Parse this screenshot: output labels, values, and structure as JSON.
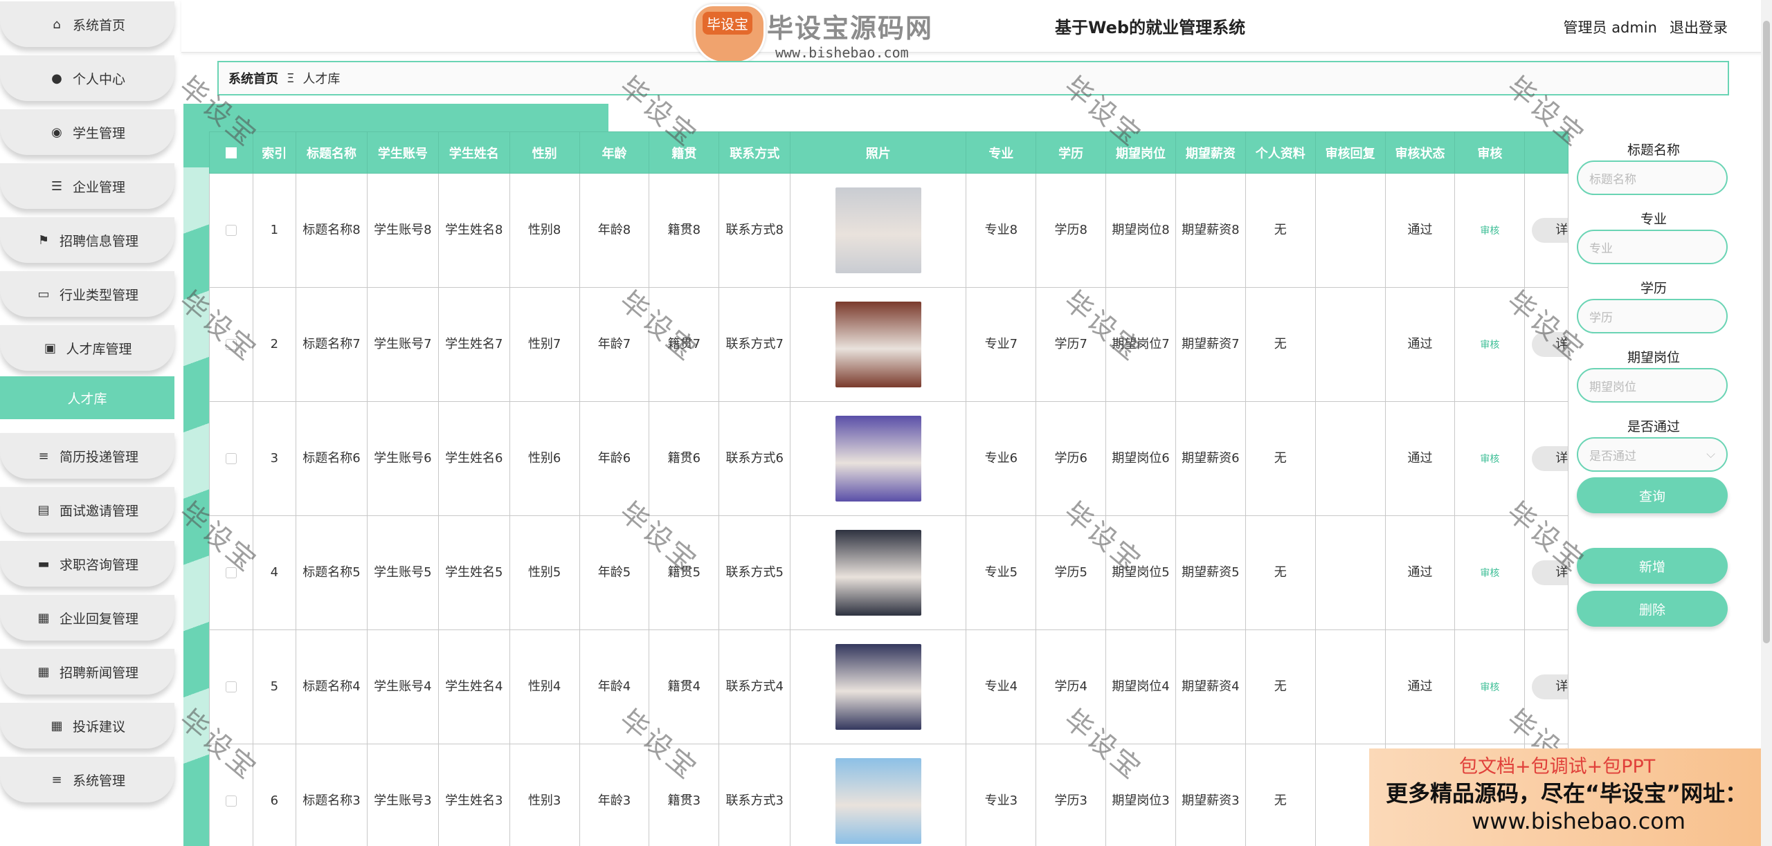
{
  "sidebar": {
    "items": [
      {
        "label": "系统首页",
        "icon": "home-icon"
      },
      {
        "label": "个人中心",
        "icon": "user-icon"
      },
      {
        "label": "学生管理",
        "icon": "pin-icon"
      },
      {
        "label": "企业管理",
        "icon": "sliders-icon"
      },
      {
        "label": "招聘信息管理",
        "icon": "flag-icon"
      },
      {
        "label": "行业类型管理",
        "icon": "monitor-icon"
      },
      {
        "label": "人才库管理",
        "icon": "briefcase-icon"
      },
      {
        "label": "简历投递管理",
        "icon": "list-icon"
      },
      {
        "label": "面试邀请管理",
        "icon": "clipboard-icon"
      },
      {
        "label": "求职咨询管理",
        "icon": "tray-icon"
      },
      {
        "label": "企业回复管理",
        "icon": "grid-icon"
      },
      {
        "label": "招聘新闻管理",
        "icon": "grid-icon"
      },
      {
        "label": "投诉建议",
        "icon": "grid-icon"
      },
      {
        "label": "系统管理",
        "icon": "list-icon"
      }
    ],
    "active_sub": "人才库"
  },
  "header": {
    "title": "基于Web的就业管理系统",
    "user": "管理员 admin",
    "logout": "退出登录"
  },
  "breadcrumb": {
    "home": "系统首页",
    "sep": "Ξ",
    "current": "人才库"
  },
  "table": {
    "columns": [
      "索引",
      "标题名称",
      "学生账号",
      "学生姓名",
      "性别",
      "年龄",
      "籍贯",
      "联系方式",
      "照片",
      "专业",
      "学历",
      "期望岗位",
      "期望薪资",
      "个人资料",
      "审核回复",
      "审核状态",
      "审核",
      ""
    ],
    "rows": [
      {
        "idx": "1",
        "title": "标题名称8",
        "account": "学生账号8",
        "name": "学生姓名8",
        "gender": "性别8",
        "age": "年龄8",
        "origin": "籍贯8",
        "contact": "联系方式8",
        "major": "专业8",
        "edu": "学历8",
        "post": "期望岗位8",
        "salary": "期望薪资8",
        "profile": "无",
        "reply": "",
        "status": "通过",
        "audit": "审核",
        "detail": "详",
        "photo_color": "#c9ccd2"
      },
      {
        "idx": "2",
        "title": "标题名称7",
        "account": "学生账号7",
        "name": "学生姓名7",
        "gender": "性别7",
        "age": "年龄7",
        "origin": "籍贯7",
        "contact": "联系方式7",
        "major": "专业7",
        "edu": "学历7",
        "post": "期望岗位7",
        "salary": "期望薪资7",
        "profile": "无",
        "reply": "",
        "status": "通过",
        "audit": "审核",
        "detail": "详",
        "photo_color": "#7a3a2c"
      },
      {
        "idx": "3",
        "title": "标题名称6",
        "account": "学生账号6",
        "name": "学生姓名6",
        "gender": "性别6",
        "age": "年龄6",
        "origin": "籍贯6",
        "contact": "联系方式6",
        "major": "专业6",
        "edu": "学历6",
        "post": "期望岗位6",
        "salary": "期望薪资6",
        "profile": "无",
        "reply": "",
        "status": "通过",
        "audit": "审核",
        "detail": "详",
        "photo_color": "#5a4fa8"
      },
      {
        "idx": "4",
        "title": "标题名称5",
        "account": "学生账号5",
        "name": "学生姓名5",
        "gender": "性别5",
        "age": "年龄5",
        "origin": "籍贯5",
        "contact": "联系方式5",
        "major": "专业5",
        "edu": "学历5",
        "post": "期望岗位5",
        "salary": "期望薪资5",
        "profile": "无",
        "reply": "",
        "status": "通过",
        "audit": "审核",
        "detail": "详",
        "photo_color": "#2e3240"
      },
      {
        "idx": "5",
        "title": "标题名称4",
        "account": "学生账号4",
        "name": "学生姓名4",
        "gender": "性别4",
        "age": "年龄4",
        "origin": "籍贯4",
        "contact": "联系方式4",
        "major": "专业4",
        "edu": "学历4",
        "post": "期望岗位4",
        "salary": "期望薪资4",
        "profile": "无",
        "reply": "",
        "status": "通过",
        "audit": "审核",
        "detail": "详",
        "photo_color": "#34385e"
      },
      {
        "idx": "6",
        "title": "标题名称3",
        "account": "学生账号3",
        "name": "学生姓名3",
        "gender": "性别3",
        "age": "年龄3",
        "origin": "籍贯3",
        "contact": "联系方式3",
        "major": "专业3",
        "edu": "学历3",
        "post": "期望岗位3",
        "salary": "期望薪资3",
        "profile": "无",
        "reply": "",
        "status": "",
        "audit": "",
        "detail": "",
        "photo_color": "#8cc0e6"
      }
    ]
  },
  "search": {
    "fields": [
      {
        "label": "标题名称",
        "placeholder": "标题名称"
      },
      {
        "label": "专业",
        "placeholder": "专业"
      },
      {
        "label": "学历",
        "placeholder": "学历"
      },
      {
        "label": "期望岗位",
        "placeholder": "期望岗位"
      }
    ],
    "select": {
      "label": "是否通过",
      "placeholder": "是否通过"
    },
    "query": "查询",
    "add": "新增",
    "delete": "删除"
  },
  "watermark": {
    "text": "毕设宝",
    "logo_badge": "毕设宝",
    "logo_text": "毕设宝源码网",
    "url": "www.bishebao.com"
  },
  "ad": {
    "line1": "包文档+包调试+包PPT",
    "line2": "更多精品源码，尽在“毕设宝”网址：",
    "line3": "www.bishebao.com"
  },
  "colors": {
    "accent": "#6ad4b4",
    "audit": "#3fbf97"
  }
}
